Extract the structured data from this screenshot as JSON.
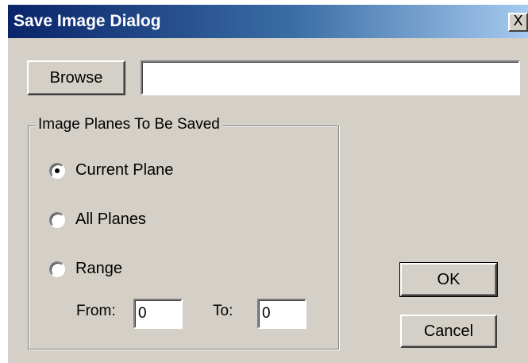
{
  "window": {
    "title": "Save Image Dialog",
    "close_glyph": "X"
  },
  "file": {
    "browse_label": "Browse",
    "path_value": ""
  },
  "planes_group": {
    "label": "Image Planes To Be Saved",
    "options": [
      {
        "label": "Current Plane",
        "selected": true
      },
      {
        "label": "All Planes",
        "selected": false
      },
      {
        "label": "Range",
        "selected": false
      }
    ],
    "from_label": "From:",
    "from_value": "0",
    "to_label": "To:",
    "to_value": "0"
  },
  "actions": {
    "ok_label": "OK",
    "cancel_label": "Cancel"
  },
  "colors": {
    "title_gradient_start": "#0a246a",
    "title_gradient_end": "#a6caf0",
    "dialog_bg": "#d4d0c8"
  }
}
